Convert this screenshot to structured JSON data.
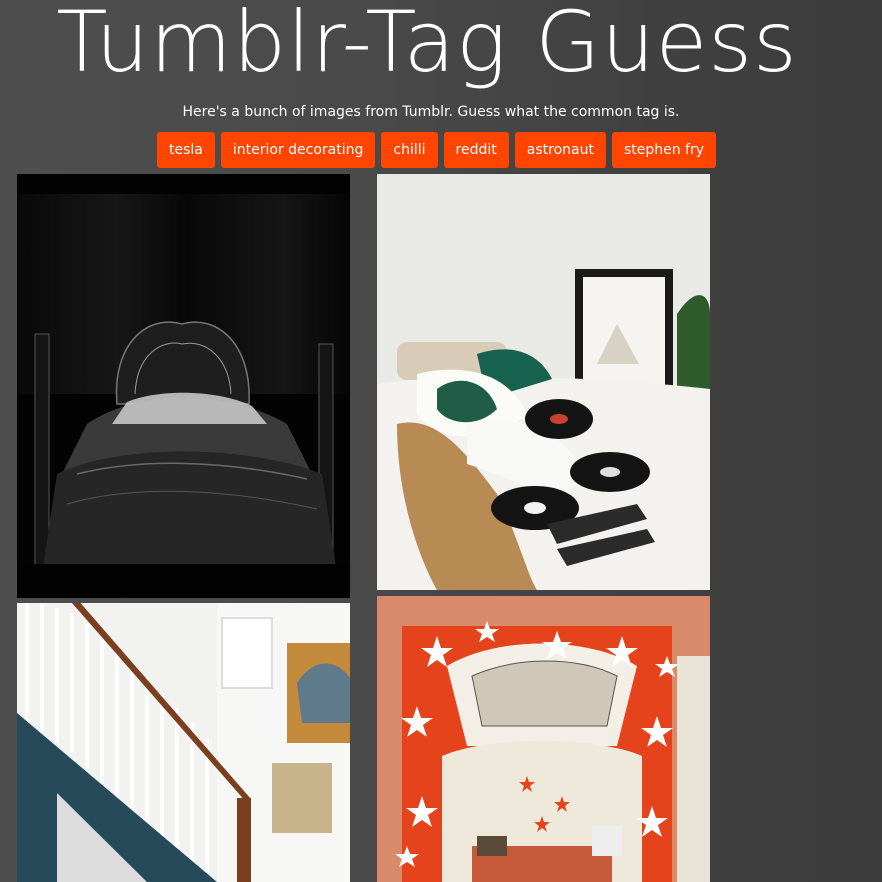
{
  "header": {
    "title": "Tumblr-Tag Guess",
    "subtitle": "Here's a bunch of images from Tumblr. Guess what the common tag is."
  },
  "options": [
    {
      "label": "tesla"
    },
    {
      "label": "interior decorating"
    },
    {
      "label": "chilli"
    },
    {
      "label": "reddit"
    },
    {
      "label": "astronaut"
    },
    {
      "label": "stephen fry"
    }
  ],
  "images": [
    {
      "name": "dark-ornate-bedroom-image"
    },
    {
      "name": "vinyl-records-bed-image"
    },
    {
      "name": "staircase-image"
    },
    {
      "name": "star-bunk-bed-image"
    }
  ],
  "colors": {
    "accent": "#ff4500",
    "background": "#4a4a4a"
  }
}
